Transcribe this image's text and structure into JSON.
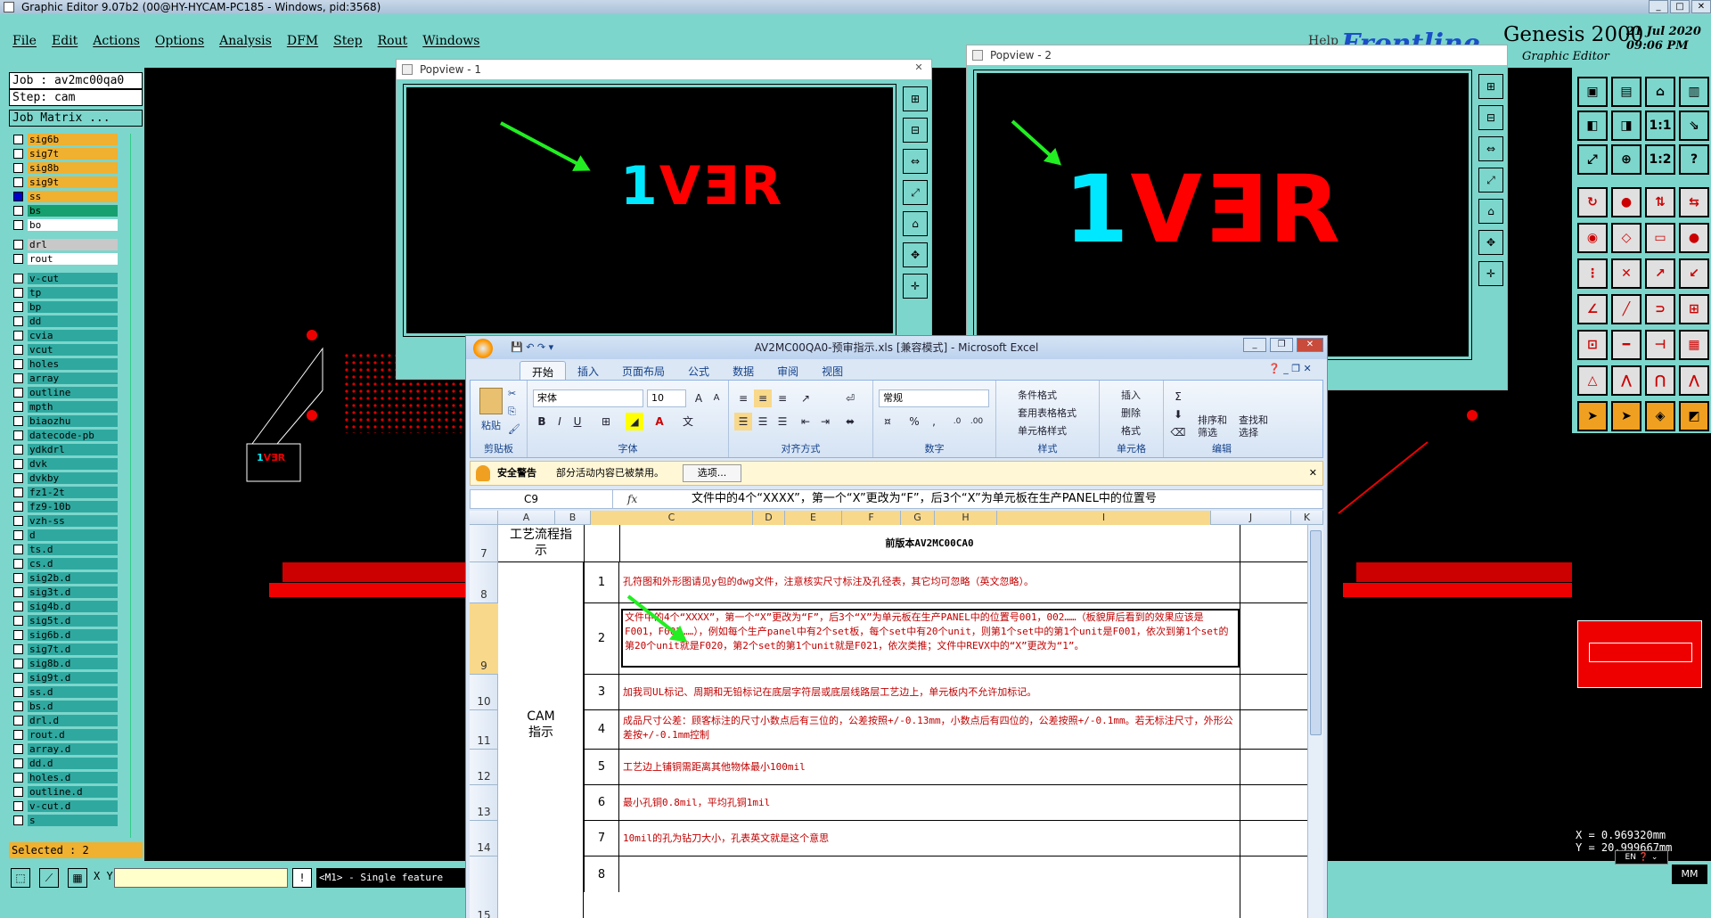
{
  "window": {
    "title": "Graphic Editor 9.07b2 (00@HY-HYCAM-PC185 - Windows, pid:3568)"
  },
  "menu": [
    "File",
    "Edit",
    "Actions",
    "Options",
    "Analysis",
    "DFM",
    "Step",
    "Rout",
    "Windows"
  ],
  "help_label": "Help",
  "brand": {
    "logo": "Frontline",
    "product": "Genesis 2000",
    "subtitle": "Graphic Editor",
    "date": "21 Jul 2020",
    "time": "09:06 PM"
  },
  "job": {
    "job_label": "Job : av2mc00qa0",
    "step_label": "Step: cam",
    "matrix_button": "Job Matrix ..."
  },
  "layers": [
    {
      "name": "sig6b",
      "style": "sel"
    },
    {
      "name": "sig7t",
      "style": "sel"
    },
    {
      "name": "sig8b",
      "style": "sel"
    },
    {
      "name": "sig9t",
      "style": "sel"
    },
    {
      "name": "ss",
      "style": "sel"
    },
    {
      "name": "bs",
      "style": "gn"
    },
    {
      "name": "bo",
      "style": "wh"
    },
    {
      "name": "",
      "style": "gap"
    },
    {
      "name": "drl",
      "style": "gr"
    },
    {
      "name": "rout",
      "style": "wh"
    },
    {
      "name": "",
      "style": "gap"
    },
    {
      "name": "v-cut",
      "style": ""
    },
    {
      "name": "tp",
      "style": ""
    },
    {
      "name": "bp",
      "style": ""
    },
    {
      "name": "dd",
      "style": ""
    },
    {
      "name": "cvia",
      "style": ""
    },
    {
      "name": "vcut",
      "style": ""
    },
    {
      "name": "holes",
      "style": ""
    },
    {
      "name": "array",
      "style": ""
    },
    {
      "name": "outline",
      "style": ""
    },
    {
      "name": "mpth",
      "style": ""
    },
    {
      "name": "biaozhu",
      "style": ""
    },
    {
      "name": "datecode-pb",
      "style": ""
    },
    {
      "name": "ydkdrl",
      "style": ""
    },
    {
      "name": "dvk",
      "style": ""
    },
    {
      "name": "dvkby",
      "style": ""
    },
    {
      "name": "fz1-2t",
      "style": ""
    },
    {
      "name": "fz9-10b",
      "style": ""
    },
    {
      "name": "vzh-ss",
      "style": ""
    },
    {
      "name": "d",
      "style": ""
    },
    {
      "name": "ts.d",
      "style": ""
    },
    {
      "name": "cs.d",
      "style": ""
    },
    {
      "name": "sig2b.d",
      "style": ""
    },
    {
      "name": "sig3t.d",
      "style": ""
    },
    {
      "name": "sig4b.d",
      "style": ""
    },
    {
      "name": "sig5t.d",
      "style": ""
    },
    {
      "name": "sig6b.d",
      "style": ""
    },
    {
      "name": "sig7t.d",
      "style": ""
    },
    {
      "name": "sig8b.d",
      "style": ""
    },
    {
      "name": "sig9t.d",
      "style": ""
    },
    {
      "name": "ss.d",
      "style": ""
    },
    {
      "name": "bs.d",
      "style": ""
    },
    {
      "name": "drl.d",
      "style": ""
    },
    {
      "name": "rout.d",
      "style": ""
    },
    {
      "name": "array.d",
      "style": ""
    },
    {
      "name": "dd.d",
      "style": ""
    },
    {
      "name": "holes.d",
      "style": ""
    },
    {
      "name": "outline.d",
      "style": ""
    },
    {
      "name": "v-cut.d",
      "style": ""
    },
    {
      "name": "s",
      "style": ""
    }
  ],
  "selected_label": "Selected : 2",
  "bottom": {
    "xy_label": "X Y :",
    "xy_value": "",
    "message": "<M1> - Single feature"
  },
  "coords": {
    "x": "X = 0.969320mm",
    "y": "Y = 20.999667mm",
    "units": "MM"
  },
  "popview1": {
    "title": "Popview - 1",
    "text_main": "VƎR",
    "text_one": "1"
  },
  "popview2": {
    "title": "Popview - 2",
    "text_main": "VƎR",
    "text_one": "1"
  },
  "minimap_text": "1VƎR",
  "excel": {
    "title": "AV2MC00QA0-预审指示.xls  [兼容模式] - Microsoft Excel",
    "tabs": [
      "开始",
      "插入",
      "页面布局",
      "公式",
      "数据",
      "审阅",
      "视图"
    ],
    "font_name": "宋体",
    "font_size": "10",
    "number_format": "常规",
    "groups": [
      "剪贴板",
      "字体",
      "对齐方式",
      "数字",
      "样式",
      "单元格",
      "编辑"
    ],
    "paste_label": "粘贴",
    "style_items": [
      "条件格式",
      "套用表格格式",
      "单元格样式"
    ],
    "cell_items": [
      "插入",
      "删除",
      "格式"
    ],
    "edit_items": [
      "排序和筛选",
      "查找和选择"
    ],
    "security_title": "安全警告",
    "security_text": "部分活动内容已被禁用。",
    "security_button": "选项...",
    "name_box": "C9",
    "formula": "文件中的4个“XXXX”，第一个“X”更改为“F”，后3个“X”为单元板在生产PANEL中的位置号",
    "columns": [
      "A",
      "B",
      "C",
      "D",
      "E",
      "F",
      "G",
      "H",
      "I",
      "J",
      "K"
    ],
    "header_left": "工艺流程指示",
    "header_right": "前版本AV2MC00CA0",
    "cam_label": "CAM指示",
    "rows": [
      {
        "row": "7",
        "num": "",
        "text": ""
      },
      {
        "row": "8",
        "num": "1",
        "text": "孔符图和外形图请见y包的dwg文件，注意核实尺寸标注及孔径表，其它均可忽略（英文忽略）。"
      },
      {
        "row": "9",
        "num": "2",
        "text": "文件中的4个“XXXX”，第一个“X”更改为“F”，后3个“X”为单元板在生产PANEL中的位置号001，002……（板貌屏后看到的效果应该是F001，F002……），例如每个生产panel中有2个set板，每个set中有20个unit，则第1个set中的第1个unit是F001，依次到第1个set的第20个unit就是F020，第2个set的第1个unit就是F021，依次类推；文件中REVX中的“X”更改为“1”。"
      },
      {
        "row": "10",
        "num": "3",
        "text": "加我司UL标记、周期和无铅标记在底层字符层或底层线路层工艺边上，单元板内不允许加标记。"
      },
      {
        "row": "11",
        "num": "4",
        "text": "成品尺寸公差：顾客标注的尺寸小数点后有三位的，公差按照+/-0.13mm，小数点后有四位的，公差按照+/-0.1mm。若无标注尺寸，外形公差按+/-0.1mm控制"
      },
      {
        "row": "12",
        "num": "5",
        "text": "工艺边上铺铜需距离其他物体最小100mil"
      },
      {
        "row": "13",
        "num": "6",
        "text": "最小孔铜0.8mil，平均孔铜1mil"
      },
      {
        "row": "14",
        "num": "7",
        "text": "10mil的孔为钻刀大小，孔表英文就是这个意思"
      },
      {
        "row": "15",
        "num": "8",
        "text": ""
      }
    ]
  },
  "colors": {
    "panel": "#7cd6cc",
    "rev_red": "#ff0000",
    "rev_cyan": "#00e8ff",
    "arrow": "#22ee22"
  }
}
